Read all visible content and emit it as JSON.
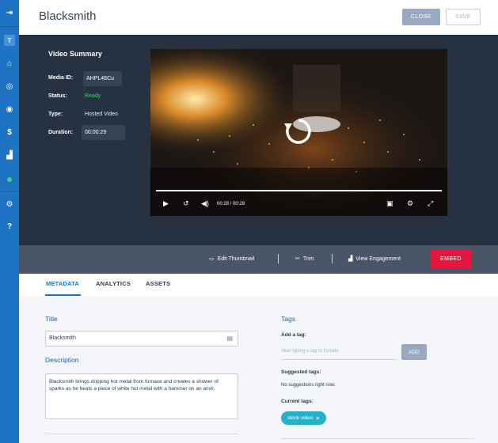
{
  "header": {
    "title": "Blacksmith",
    "close_label": "CLOSE",
    "save_label": "SAVE"
  },
  "sidebar": {
    "items": [
      {
        "icon": "collapse-arrow-icon",
        "glyph": "⇥"
      },
      {
        "icon": "workspace-badge-icon",
        "glyph": "T"
      },
      {
        "icon": "home-icon",
        "glyph": "⌂"
      },
      {
        "icon": "globe-icon",
        "glyph": "◎"
      },
      {
        "icon": "eye-icon",
        "glyph": "◉"
      },
      {
        "icon": "dollar-icon",
        "glyph": "$"
      },
      {
        "icon": "analytics-icon",
        "glyph": "▟"
      },
      {
        "icon": "status-dot-icon",
        "glyph": ""
      },
      {
        "icon": "settings-gear-icon",
        "glyph": "⚙"
      },
      {
        "icon": "help-icon",
        "glyph": "?"
      }
    ]
  },
  "summary": {
    "title": "Video Summary",
    "media_id_label": "Media ID:",
    "media_id": "AHPL48Cu",
    "status_label": "Status:",
    "status": "Ready",
    "type_label": "Type:",
    "type": "Hosted Video",
    "duration_label": "Duration:",
    "duration": "00:00:29"
  },
  "player": {
    "timecode": "00:28 / 00:28",
    "progress": 1.0
  },
  "actions": {
    "edit_thumbnail": "Edit Thumbnail",
    "trim": "Trim",
    "view_engagement": "View Engagement",
    "embed": "EMBED"
  },
  "tabs": [
    "METADATA",
    "ANALYTICS",
    "ASSETS"
  ],
  "metadata": {
    "title_heading": "Title",
    "title_value": "Blacksmith",
    "description_heading": "Description",
    "description_value": "Blacksmith brings dripping hot metal from furnace and creates a shower of sparks as he beats a piece of white hot metal with a hammer on an anvil."
  },
  "tags": {
    "heading": "Tags",
    "add_label": "Add a tag:",
    "input_placeholder": "Start typing a tag to include",
    "add_button": "ADD",
    "suggested_label": "Suggested tags:",
    "suggested_text": "No suggestions right now.",
    "current_label": "Current tags:",
    "current": [
      "stock video"
    ]
  },
  "colors": {
    "sidebar": "#1f73c4",
    "accent": "#1f73c4",
    "embed": "#e5173f",
    "ready": "#3fd66b",
    "tag": "#26b1c8"
  }
}
